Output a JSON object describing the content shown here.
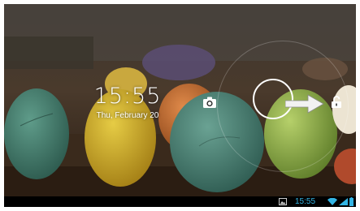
{
  "lockscreen": {
    "time": "15:55",
    "date": "Thu, February 20"
  },
  "status_bar": {
    "time": "15:55"
  },
  "icons": {
    "camera": "camera-icon",
    "unlock": "unlock-icon",
    "slide_arrow": "arrow-right-icon",
    "notification": "image-notification-icon",
    "wifi": "wifi-icon",
    "signal": "cell-signal-icon",
    "battery": "battery-icon"
  },
  "colors": {
    "status_accent": "#33b5e5",
    "status_bar_bg": "#000000",
    "clock_text": "#ffffff"
  }
}
